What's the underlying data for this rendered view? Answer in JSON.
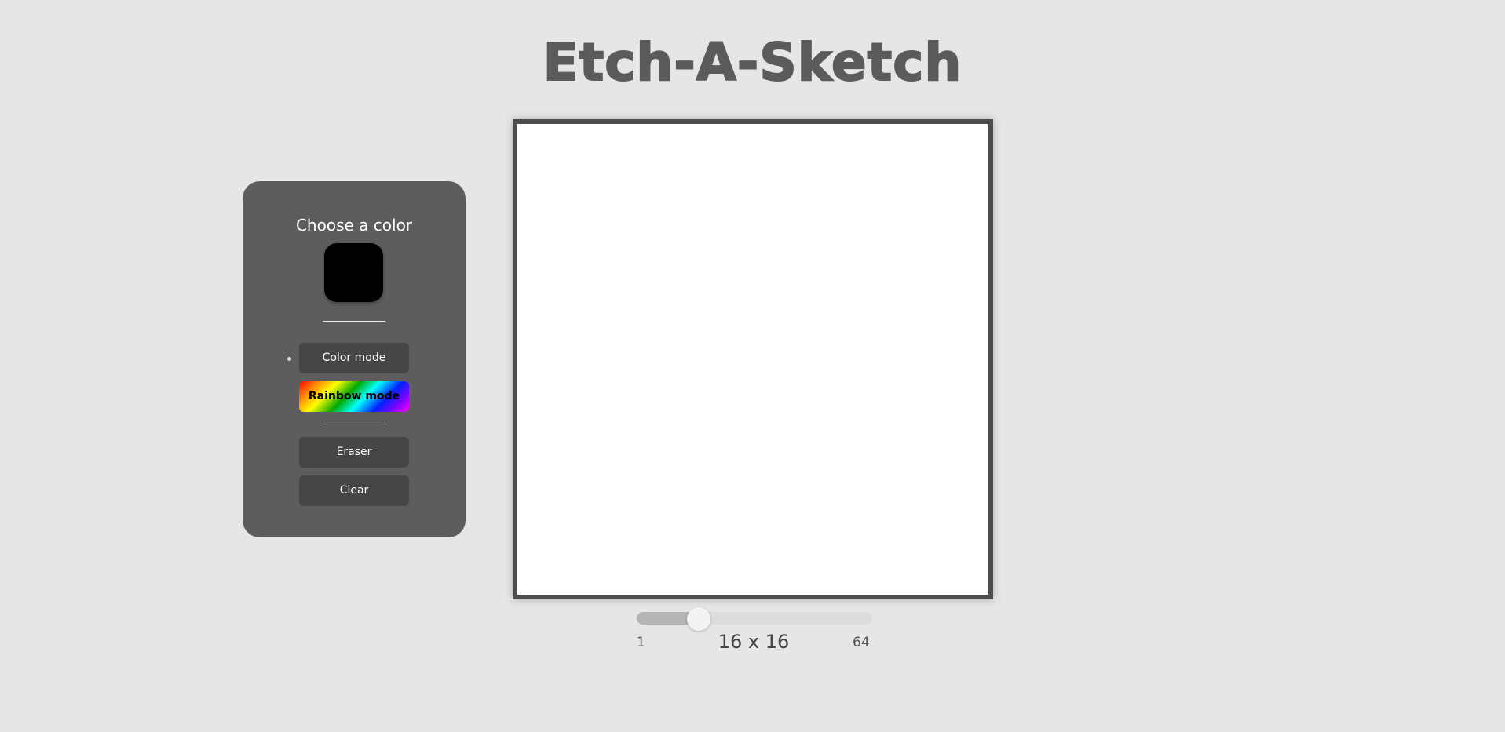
{
  "app": {
    "title": "Etch-A-Sketch"
  },
  "panel": {
    "heading": "Choose a color",
    "selected_color": "#000000",
    "buttons": {
      "color_mode": "Color mode",
      "rainbow_mode": "Rainbow mode",
      "eraser": "Eraser",
      "clear": "Clear"
    },
    "active_mode": "Color mode"
  },
  "board": {
    "background": "#ffffff",
    "border_color": "#4d4d4d",
    "grid_size": 16
  },
  "slider": {
    "min_label": "1",
    "max_label": "64",
    "min": 1,
    "max": 64,
    "value": 16,
    "size_label": "16 x 16"
  },
  "colors": {
    "page_background": "#e6e6e6",
    "panel_background": "#5d5d5d",
    "button_background": "#474646",
    "title_color": "#5b5b5b"
  }
}
